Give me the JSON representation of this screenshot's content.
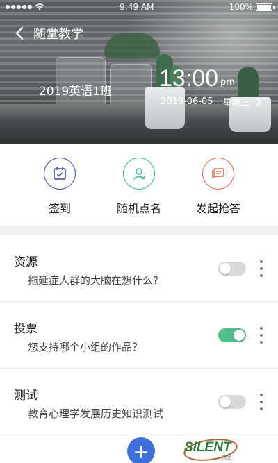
{
  "status_bar": {
    "time": "9:49 AM",
    "battery": "100%"
  },
  "header": {
    "title": "随堂教学",
    "class_name": "2019英语1班",
    "time": "13:00",
    "meridiem": "pm",
    "date": "2019-06-05",
    "weekday": "星期三"
  },
  "actions": [
    {
      "label": "签到",
      "icon": "calendar-check-icon",
      "color": "#3d4fa3"
    },
    {
      "label": "随机点名",
      "icon": "user-icon",
      "color": "#3cb99a"
    },
    {
      "label": "发起抢答",
      "icon": "message-icon",
      "color": "#e3694f"
    }
  ],
  "list": [
    {
      "title": "资源",
      "subtitle": "拖延症人群的大脑在想什么?",
      "toggle_on": false
    },
    {
      "title": "投票",
      "subtitle": "您支持哪个小组的作品？",
      "toggle_on": true
    },
    {
      "title": "测试",
      "subtitle": "教育心理学发展历史知识测试",
      "toggle_on": false
    }
  ],
  "colors": {
    "accent_green": "#4fc08d",
    "fab_blue": "#3f6fd8"
  },
  "fab": {
    "icon": "plus-icon",
    "symbol": "+"
  },
  "watermark": {
    "text": "SILENT",
    "subtext": "精品"
  }
}
